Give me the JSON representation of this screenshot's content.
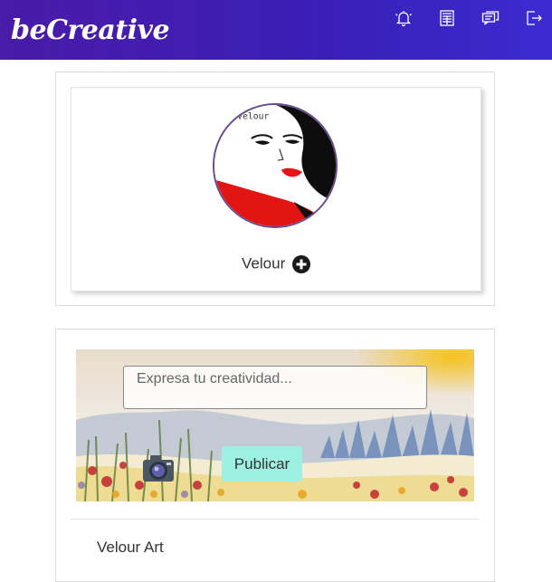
{
  "header": {
    "brand": "beCreative",
    "icons": [
      "bell-icon",
      "newspaper-icon",
      "chat-icon",
      "logout-icon"
    ],
    "color": "#3a1fb7"
  },
  "profile": {
    "name": "Velour",
    "avatar_text": "Velour",
    "add_icon": "plus-circle-icon"
  },
  "post": {
    "placeholder": "Expresa tu creatividad...",
    "publish_label": "Publicar",
    "button_color": "#9ef0e0",
    "camera_icon": "camera-icon"
  },
  "feed": {
    "author": "Velour Art"
  }
}
